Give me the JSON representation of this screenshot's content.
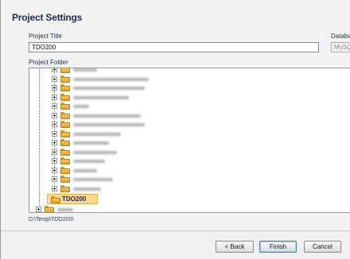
{
  "dialog": {
    "title": "Project Settings"
  },
  "form": {
    "project_title_label": "Project Title",
    "project_title_value": "TDO200",
    "database_label": "Databa",
    "database_value": "MySQ",
    "project_folder_label": "Project Folder"
  },
  "tree": {
    "selected_folder": "TDO200",
    "blurred_item_count": 15
  },
  "path": "D:\\Temp\\TDO200\\",
  "buttons": {
    "back": "< Back",
    "finish": "Finish",
    "cancel": "Cancel"
  },
  "colors": {
    "selection_bg": "#ffd891",
    "folder": "#f6c95a",
    "title_text": "#1a2a56"
  }
}
